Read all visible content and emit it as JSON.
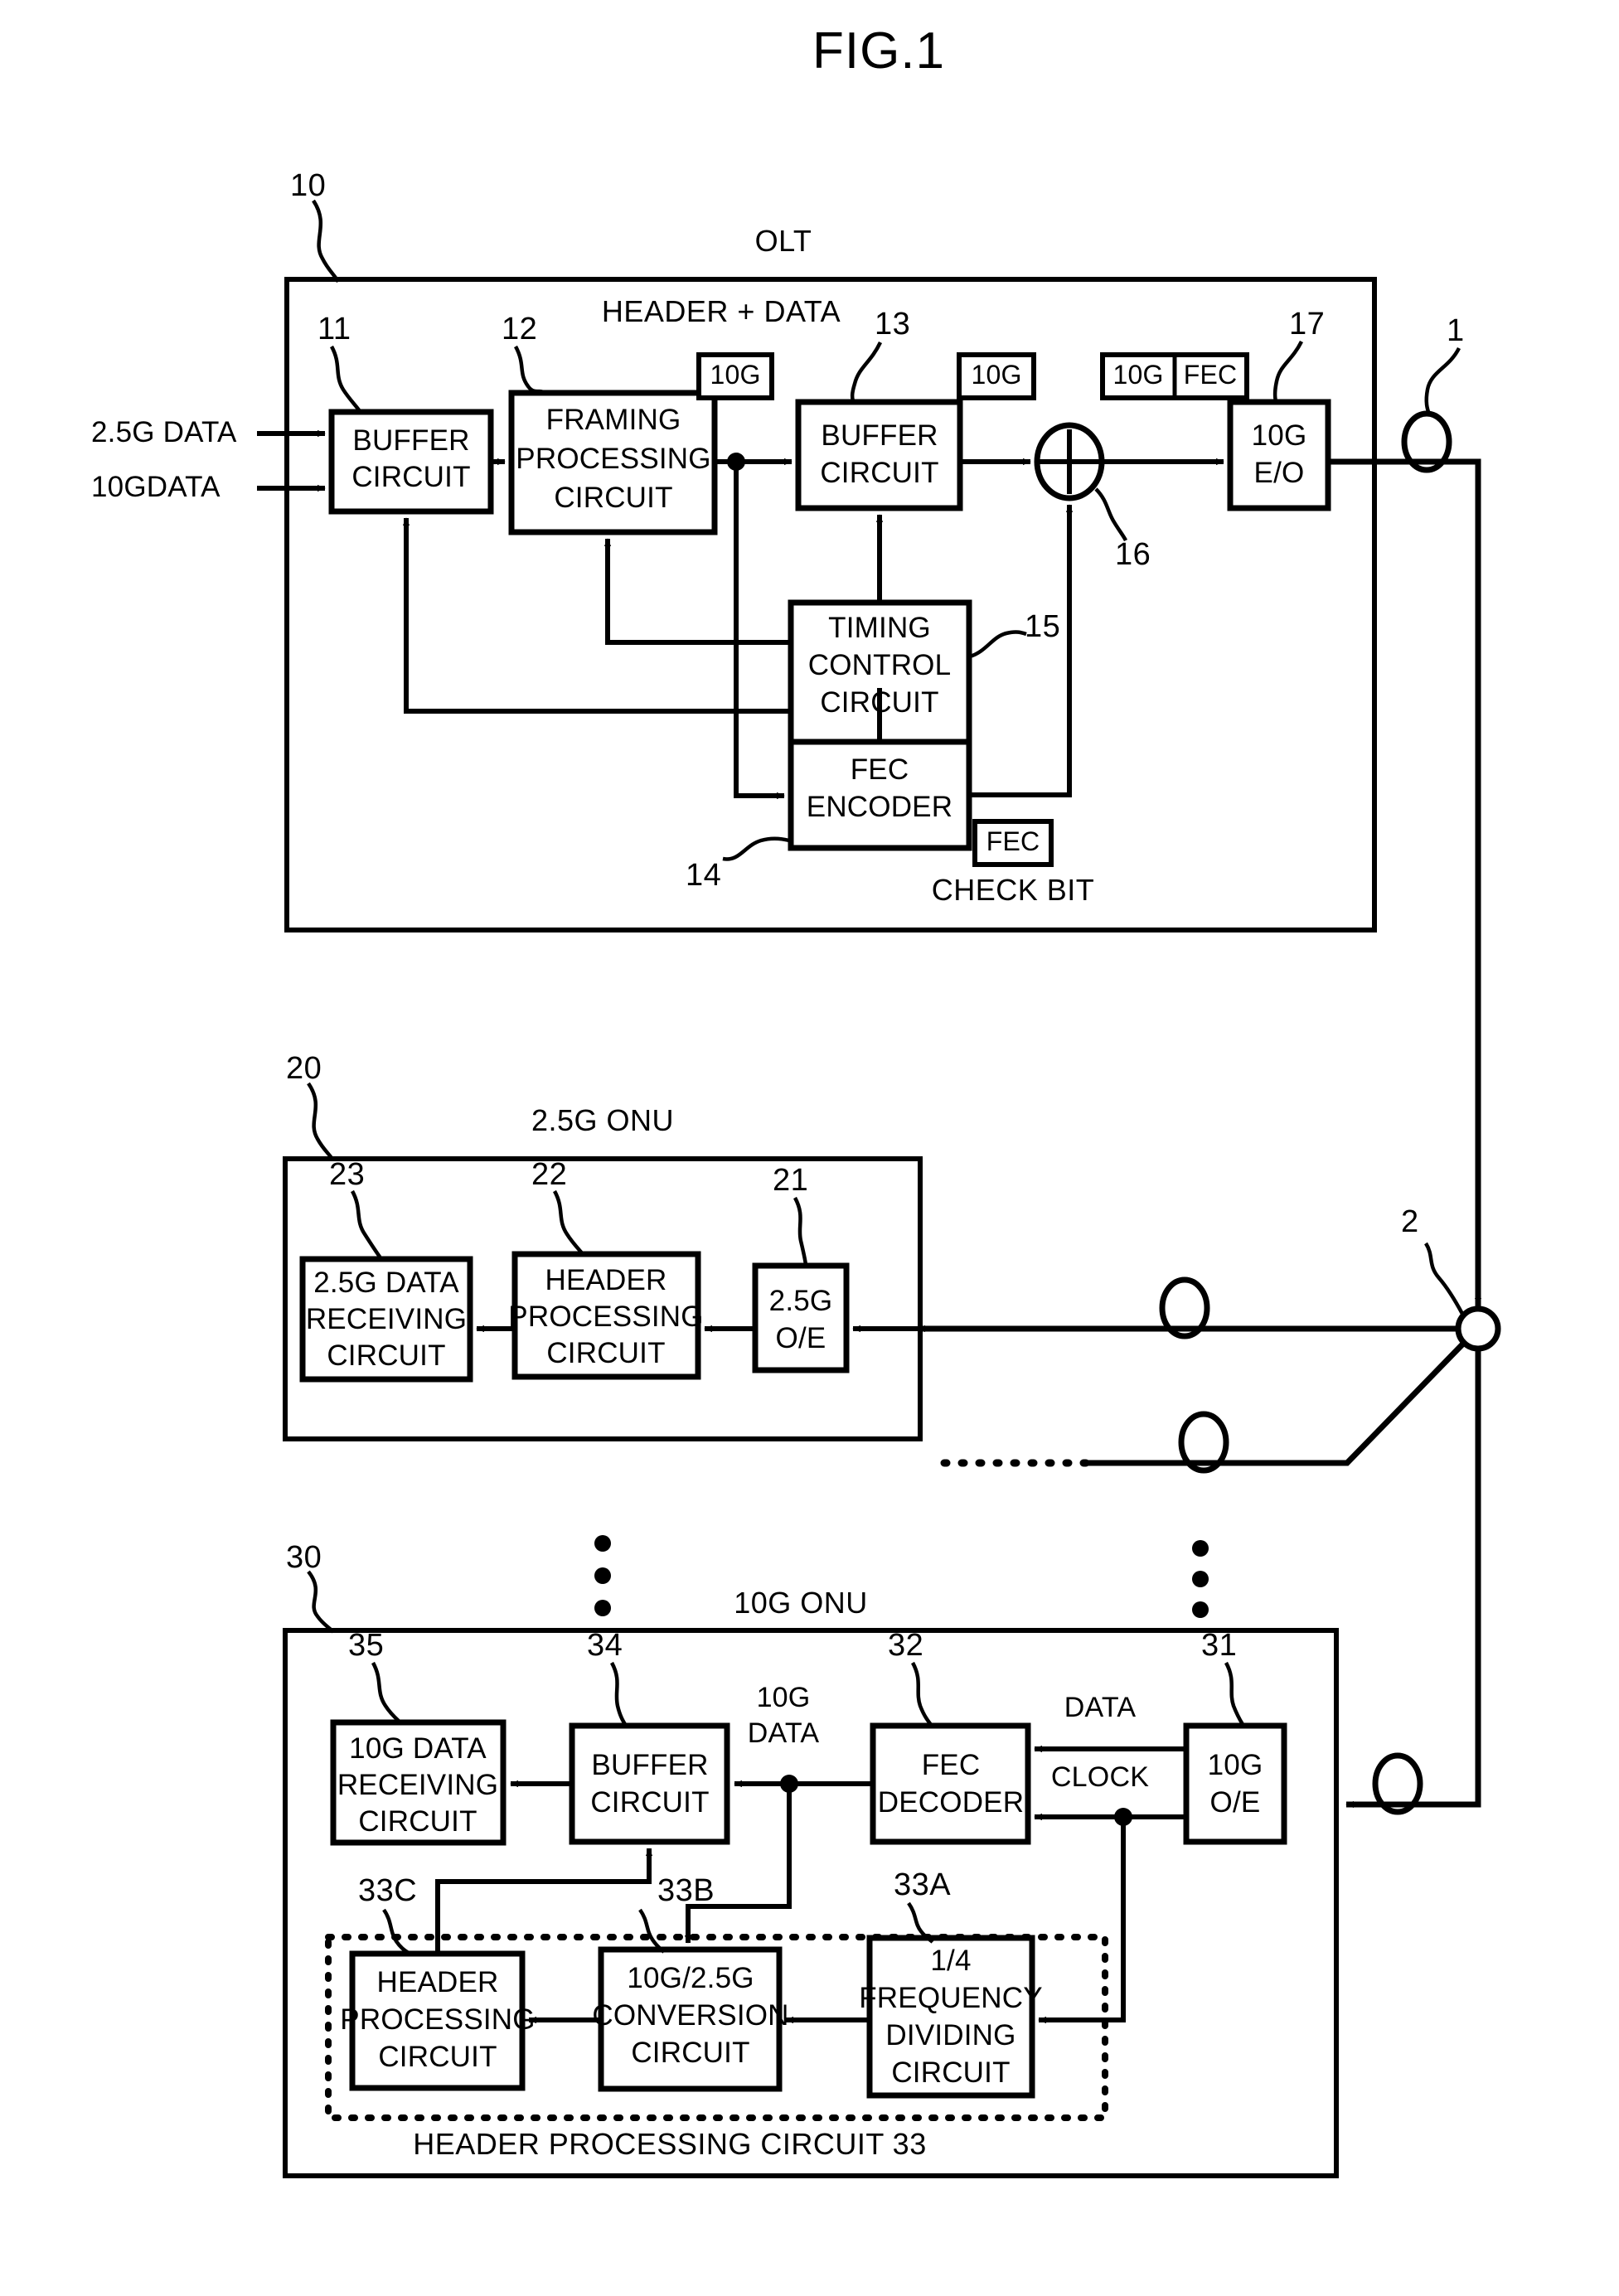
{
  "figure": {
    "title": "FIG.1",
    "type": "patent-block-diagram"
  },
  "olt": {
    "ref": "10",
    "title": "OLT",
    "flow_label": "HEADER + DATA",
    "check_bit_label": "CHECK BIT",
    "inputs": [
      {
        "label": "2.5G DATA"
      },
      {
        "label": "10GDATA"
      }
    ],
    "blocks": [
      {
        "ref": "11",
        "lines": [
          "BUFFER",
          "CIRCUIT"
        ]
      },
      {
        "ref": "12",
        "lines": [
          "FRAMING",
          "PROCESSING",
          "CIRCUIT"
        ]
      },
      {
        "ref": "13",
        "lines": [
          "BUFFER",
          "CIRCUIT"
        ]
      },
      {
        "ref": "14",
        "lines": [
          "FEC",
          "ENCODER"
        ]
      },
      {
        "ref": "15",
        "lines": [
          "TIMING",
          "CONTROL",
          "CIRCUIT"
        ]
      },
      {
        "ref": "16",
        "lines": [
          "+"
        ]
      },
      {
        "ref": "17",
        "lines": [
          "10G",
          "E/O"
        ]
      }
    ],
    "frame_tags": [
      {
        "cells": [
          "10G"
        ]
      },
      {
        "cells": [
          "10G"
        ]
      },
      {
        "cells": [
          "10G",
          "FEC"
        ]
      },
      {
        "cells": [
          "FEC"
        ]
      }
    ]
  },
  "fiber": {
    "trunk_ref": "1",
    "splitter_ref": "2"
  },
  "onu_25g": {
    "ref": "20",
    "title": "2.5G ONU",
    "blocks": [
      {
        "ref": "23",
        "lines": [
          "2.5G DATA",
          "RECEIVING",
          "CIRCUIT"
        ]
      },
      {
        "ref": "22",
        "lines": [
          "HEADER",
          "PROCESSING",
          "CIRCUIT"
        ]
      },
      {
        "ref": "21",
        "lines": [
          "2.5G",
          "O/E"
        ]
      }
    ]
  },
  "onu_10g": {
    "ref": "30",
    "title": "10G ONU",
    "group_caption": "HEADER PROCESSING CIRCUIT 33",
    "blocks": [
      {
        "ref": "35",
        "lines": [
          "10G DATA",
          "RECEIVING",
          "CIRCUIT"
        ]
      },
      {
        "ref": "34",
        "lines": [
          "BUFFER",
          "CIRCUIT"
        ]
      },
      {
        "ref": "32",
        "lines": [
          "FEC",
          "DECODER"
        ]
      },
      {
        "ref": "31",
        "lines": [
          "10G",
          "O/E"
        ]
      },
      {
        "ref": "33C",
        "lines": [
          "HEADER",
          "PROCESSING",
          "CIRCUIT"
        ]
      },
      {
        "ref": "33B",
        "lines": [
          "10G/2.5G",
          "CONVERSION",
          "CIRCUIT"
        ]
      },
      {
        "ref": "33A",
        "lines": [
          "1/4",
          "FREQUENCY",
          "DIVIDING",
          "CIRCUIT"
        ]
      }
    ],
    "wire_labels": [
      {
        "text": "10G"
      },
      {
        "text": "DATA"
      },
      {
        "text": "DATA"
      },
      {
        "text": "CLOCK"
      }
    ]
  },
  "colors": {
    "ink": "#000000",
    "paper": "#ffffff"
  }
}
